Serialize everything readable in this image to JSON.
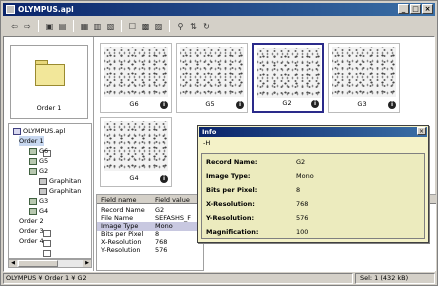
{
  "window": {
    "title": "OLYMPUS.apl",
    "min_label": "_",
    "max_label": "□",
    "close_label": "×"
  },
  "toolbar": {
    "icons": [
      "back-icon",
      "forward-icon",
      "folder-up-icon",
      "new-folder-icon",
      "view-large-icon",
      "view-list-icon",
      "view-details-icon",
      "properties-icon",
      "import-icon",
      "export-icon",
      "filter-icon",
      "sort-icon",
      "refresh-icon"
    ],
    "glyphs": [
      "⇦",
      "⇨",
      "▣",
      "▤",
      "▦",
      "▥",
      "▧",
      "☐",
      "▩",
      "▨",
      "⚲",
      "⇅",
      "↻"
    ]
  },
  "preview": {
    "label": "Order 1"
  },
  "tree": {
    "items": [
      {
        "label": "OLYMPUS.apl",
        "kind": "root"
      },
      {
        "label": "Order 1",
        "kind": "folder"
      },
      {
        "label": "G6",
        "kind": "comp"
      },
      {
        "label": "G5",
        "kind": "comp"
      },
      {
        "label": "G2",
        "kind": "comp"
      },
      {
        "label": "Graphitan",
        "kind": "img"
      },
      {
        "label": "Graphitan",
        "kind": "img"
      },
      {
        "label": "G3",
        "kind": "comp"
      },
      {
        "label": "G4",
        "kind": "comp"
      },
      {
        "label": "Order 2",
        "kind": "folder"
      },
      {
        "label": "Order 3",
        "kind": "folder"
      },
      {
        "label": "Order 4",
        "kind": "folder"
      }
    ]
  },
  "thumbs": [
    {
      "name": "G6",
      "info": "i"
    },
    {
      "name": "G5",
      "info": "i"
    },
    {
      "name": "G2",
      "info": "i"
    },
    {
      "name": "G3",
      "info": "i"
    },
    {
      "name": "G4",
      "info": "i"
    }
  ],
  "grid": {
    "col_name": "Field name",
    "col_value": "Field value",
    "rows": [
      {
        "k": "Record Name",
        "v": "G2"
      },
      {
        "k": "File Name",
        "v": "SEFASHS_F"
      },
      {
        "k": "Image Type",
        "v": "Mono"
      },
      {
        "k": "Bits per Pixel",
        "v": "8"
      },
      {
        "k": "X-Resolution",
        "v": "768"
      },
      {
        "k": "Y-Resolution",
        "v": "576"
      }
    ]
  },
  "info": {
    "title": "Info",
    "pin": "-H",
    "rows": [
      {
        "k": "Record Name:",
        "v": "G2"
      },
      {
        "k": "Image Type:",
        "v": "Mono"
      },
      {
        "k": "Bits per Pixel:",
        "v": "8"
      },
      {
        "k": "X-Resolution:",
        "v": "768"
      },
      {
        "k": "Y-Resolution:",
        "v": "576"
      },
      {
        "k": "Magnification:",
        "v": "100"
      }
    ]
  },
  "status": {
    "path": "OLYMPUS ¥ Order 1 ¥ G2",
    "selection": "Sel: 1 (432 kB)"
  }
}
